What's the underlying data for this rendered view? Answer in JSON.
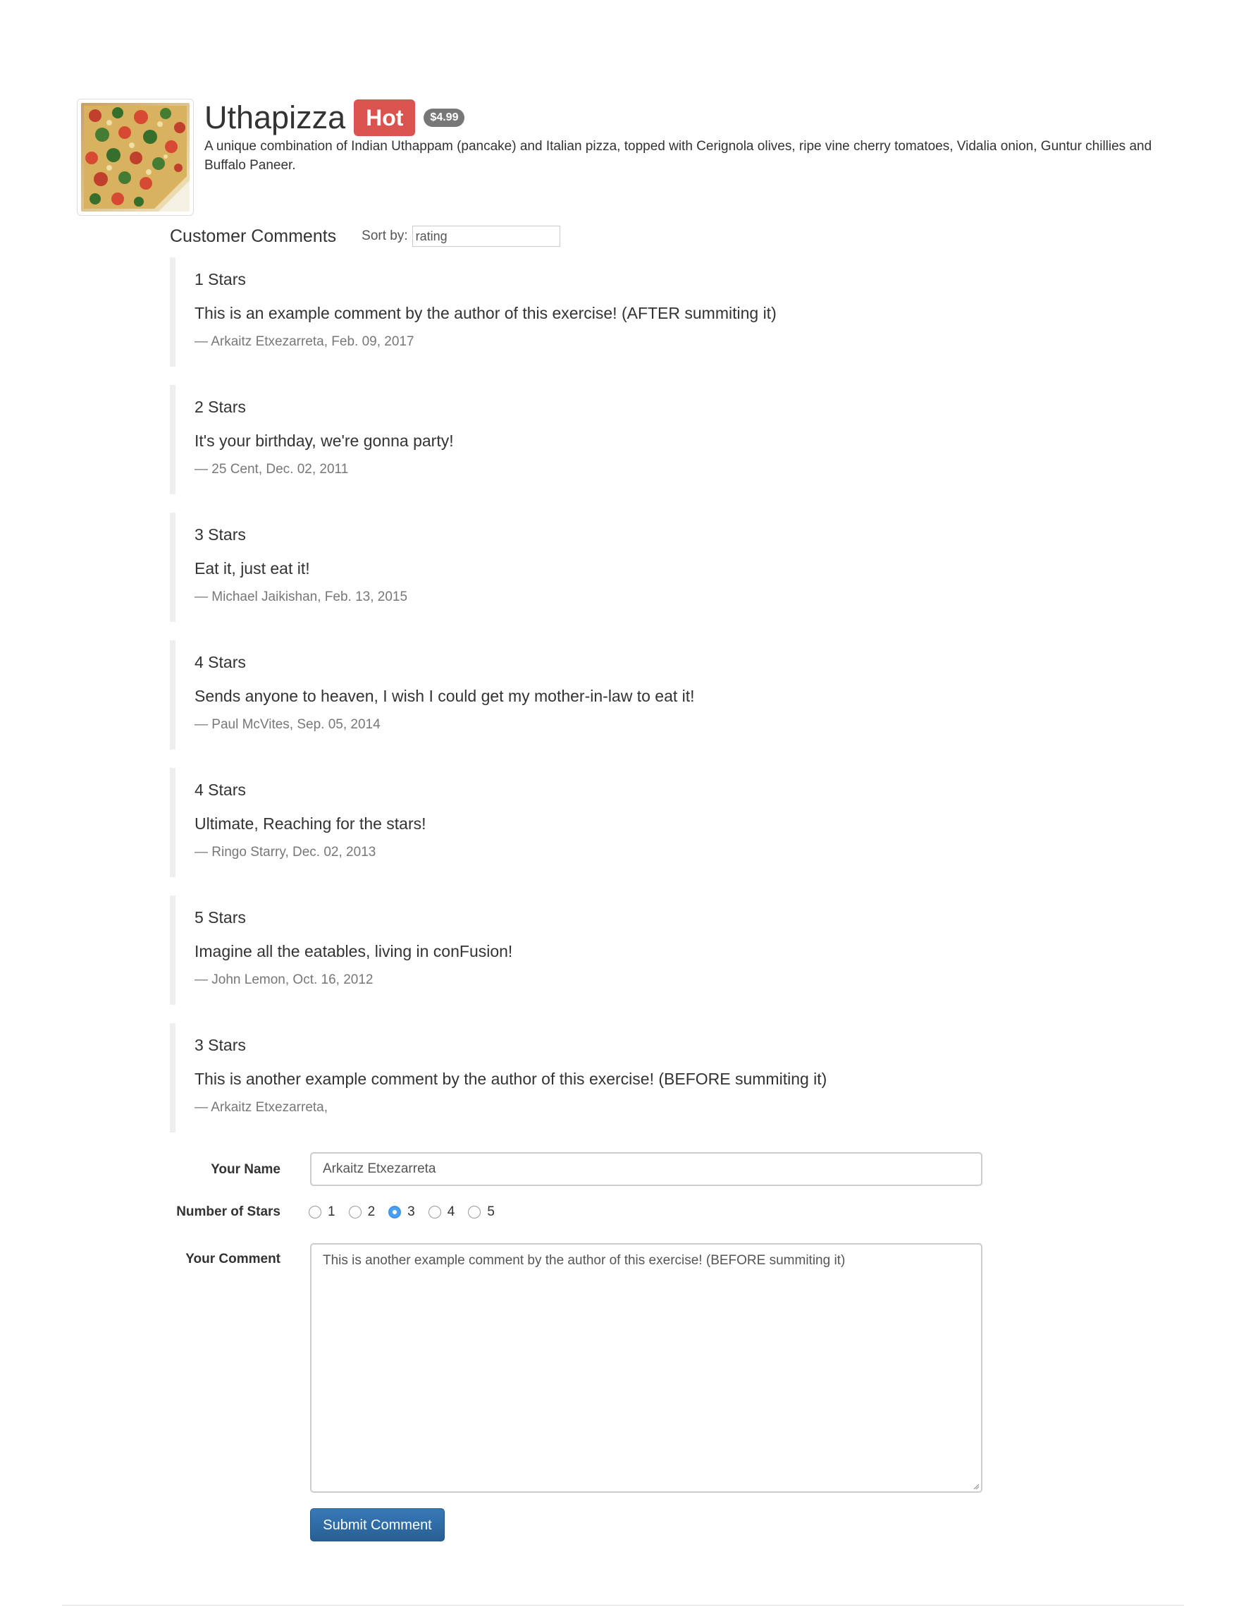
{
  "dish": {
    "image_alt": "Uthapizza",
    "name": "Uthapizza",
    "label": "Hot",
    "price": "$4.99",
    "description": "A unique combination of Indian Uthappam (pancake) and Italian pizza, topped with Cerignola olives, ripe vine cherry tomatoes, Vidalia onion, Guntur chillies and Buffalo Paneer."
  },
  "comments_section": {
    "title": "Customer Comments",
    "sort_label": "Sort by:",
    "sort_value": "rating"
  },
  "comments": [
    {
      "stars": "1 Stars",
      "text": "This is an example comment by the author of this exercise! (AFTER summiting it)",
      "meta": "— Arkaitz Etxezarreta, Feb. 09, 2017"
    },
    {
      "stars": "2 Stars",
      "text": "It's your birthday, we're gonna party!",
      "meta": "— 25 Cent, Dec. 02, 2011"
    },
    {
      "stars": "3 Stars",
      "text": "Eat it, just eat it!",
      "meta": "— Michael Jaikishan, Feb. 13, 2015"
    },
    {
      "stars": "4 Stars",
      "text": "Sends anyone to heaven, I wish I could get my mother-in-law to eat it!",
      "meta": "— Paul McVites, Sep. 05, 2014"
    },
    {
      "stars": "4 Stars",
      "text": "Ultimate, Reaching for the stars!",
      "meta": "— Ringo Starry, Dec. 02, 2013"
    },
    {
      "stars": "5 Stars",
      "text": "Imagine all the eatables, living in conFusion!",
      "meta": "— John Lemon, Oct. 16, 2012"
    },
    {
      "stars": "3 Stars",
      "text": "This is another example comment by the author of this exercise! (BEFORE summiting it)",
      "meta": "— Arkaitz Etxezarreta,"
    }
  ],
  "form": {
    "name_label": "Your Name",
    "name_value": "Arkaitz Etxezarreta",
    "stars_label": "Number of Stars",
    "star_options": [
      "1",
      "2",
      "3",
      "4",
      "5"
    ],
    "selected_star": "3",
    "comment_label": "Your Comment",
    "comment_value": "This is another example comment by the author of this exercise! (BEFORE summiting it)",
    "submit_label": "Submit Comment"
  },
  "colors": {
    "hot_label": "#d9534f",
    "price_badge": "#777777",
    "primary_button": "#286090",
    "radio_checked": "#4d9ff2"
  }
}
